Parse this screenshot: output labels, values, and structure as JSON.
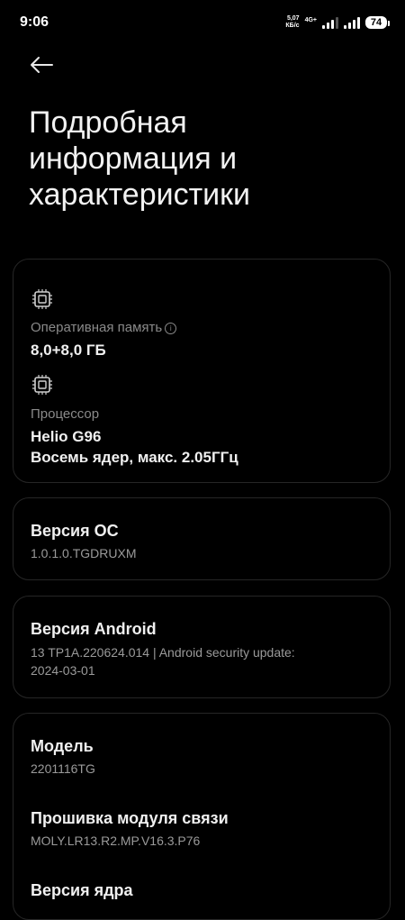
{
  "status_bar": {
    "time": "9:06",
    "net_speed_value": "5,07",
    "net_speed_unit": "КБ/с",
    "net_type": "4G+",
    "battery": "74"
  },
  "page": {
    "title_line1": "Подробная",
    "title_line2": "информация и",
    "title_line3": "характеристики"
  },
  "specs": {
    "ram_label": "Оперативная память",
    "ram_value": "8,0+8,0 ГБ",
    "cpu_label": "Процессор",
    "cpu_model": "Helio G96",
    "cpu_detail": "Восемь ядер, макс. 2.05ГГц"
  },
  "os": {
    "title": "Версия ОС",
    "value": "1.0.1.0.TGDRUXM"
  },
  "android": {
    "title": "Версия Android",
    "value_line1": "13 TP1A.220624.014 | Android security update:",
    "value_line2": "2024-03-01"
  },
  "model": {
    "title": "Модель",
    "value": "2201116TG",
    "baseband_title": "Прошивка модуля связи",
    "baseband_value": "MOLY.LR13.R2.MP.V16.3.P76",
    "kernel_title": "Версия ядра"
  },
  "icons": {
    "back": "arrow-left-icon",
    "ram": "chip-icon",
    "cpu": "processor-icon",
    "info": "info-icon"
  }
}
